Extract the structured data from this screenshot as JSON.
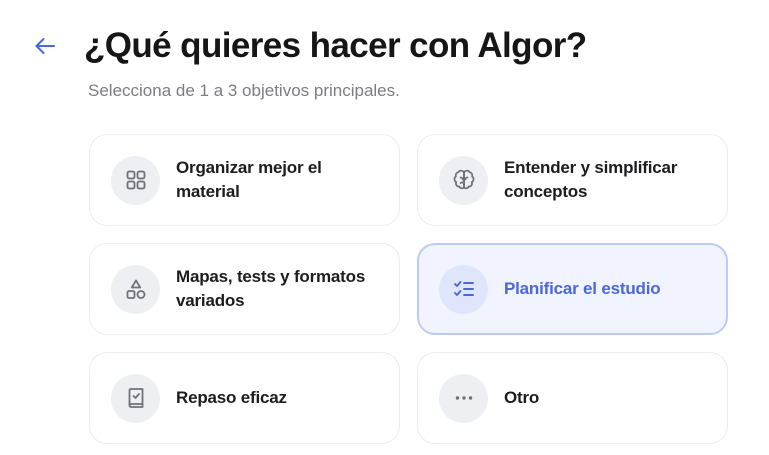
{
  "header": {
    "title": "¿Qué quieres hacer con Algor?",
    "subtitle": "Selecciona de 1 a 3 objetivos principales."
  },
  "colors": {
    "accent": "#4a68d6",
    "selected_background": "#f1f4fe",
    "selected_border": "#bccbf4"
  },
  "options": [
    {
      "label": "Organizar mejor el material",
      "icon": "grid-icon",
      "selected": false
    },
    {
      "label": "Entender y simplificar conceptos",
      "icon": "brain-icon",
      "selected": false
    },
    {
      "label": "Mapas, tests y formatos variados",
      "icon": "shapes-icon",
      "selected": false
    },
    {
      "label": "Planificar el estudio",
      "icon": "checklist-icon",
      "selected": true
    },
    {
      "label": "Repaso eficaz",
      "icon": "notebook-check-icon",
      "selected": false
    },
    {
      "label": "Otro",
      "icon": "more-icon",
      "selected": false
    }
  ]
}
